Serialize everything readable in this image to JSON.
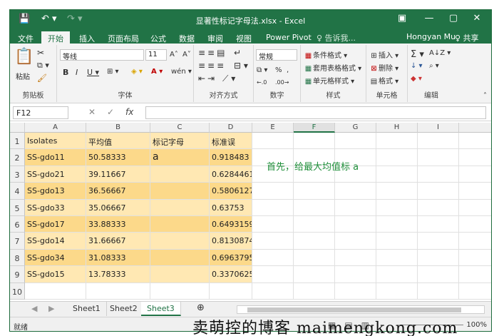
{
  "app": {
    "title": "显著性标记字母法.xlsx - Excel",
    "qa_save": "💾",
    "qa_undo": "↶ ▾",
    "qa_redo": "↷ ▾",
    "win_ribbon_opt": "▣",
    "win_min": "—",
    "win_max": "▢",
    "win_close": "✕"
  },
  "tabs": [
    "文件",
    "开始",
    "插入",
    "页面布局",
    "公式",
    "数据",
    "审阅",
    "视图",
    "Power Pivot"
  ],
  "tell_me": "♀ 告诉我...",
  "user": "Hongyan Mu",
  "share": "♀ 共享",
  "ribbon": {
    "clipboard": {
      "label": "剪贴板",
      "paste": "粘贴"
    },
    "font": {
      "label": "字体",
      "name": "等线",
      "size": "11",
      "grow": "A˄",
      "shrink": "A˅",
      "bold": "B",
      "italic": "I",
      "underline": "U ▾",
      "border": "⊞ ▾",
      "fill": "◈ ▾",
      "color": "A ▾",
      "wen": "wén ▾"
    },
    "align": {
      "label": "对齐方式"
    },
    "number": {
      "label": "数字",
      "format": "常规",
      "currency": "⧉ ▾",
      "percent": "%",
      "comma": ",",
      "inc": "←.0",
      "dec": ".00→"
    },
    "styles": {
      "label": "样式",
      "cond": "条件格式 ▾",
      "table": "套用表格格式 ▾",
      "cell": "单元格样式 ▾"
    },
    "cells": {
      "label": "单元格",
      "insert": "插入 ▾",
      "delete": "删除 ▾",
      "format": "格式 ▾"
    },
    "editing": {
      "label": "编辑",
      "sum": "Σ ▾",
      "sort": "A↓Z ▾",
      "fill": "↓ ▾",
      "find": "⌕ ▾",
      "clear": "◆ ▾"
    }
  },
  "formula_bar": {
    "name": "F12",
    "cancel": "✕",
    "enter": "✓",
    "fx": "fx",
    "value": ""
  },
  "columns": [
    "A",
    "B",
    "C",
    "D",
    "E",
    "F",
    "G",
    "H",
    "I"
  ],
  "rows": [
    "1",
    "2",
    "3",
    "4",
    "5",
    "6",
    "7",
    "8",
    "9",
    "10"
  ],
  "header_row": [
    "Isolates",
    "平均值",
    "标记字母",
    "标准误"
  ],
  "data_rows": [
    [
      "SS-gdo11",
      "50.58333",
      "a",
      "0.918483"
    ],
    [
      "SS-gdo21",
      "39.11667",
      "",
      "0.6284461"
    ],
    [
      "SS-gdo13",
      "36.56667",
      "",
      "0.5806127"
    ],
    [
      "SS-gdo33",
      "35.06667",
      "",
      "0.63753"
    ],
    [
      "SS-gdo17",
      "33.88333",
      "",
      "0.6493159"
    ],
    [
      "SS-gdo14",
      "31.66667",
      "",
      "0.8130874"
    ],
    [
      "SS-gdo34",
      "31.08333",
      "",
      "0.6963795"
    ],
    [
      "SS-gdo15",
      "13.78333",
      "",
      "0.3370625"
    ]
  ],
  "note": "首先，给最大均值标 a",
  "sheets": [
    "Sheet1",
    "Sheet2",
    "Sheet3"
  ],
  "active_sheet": "Sheet3",
  "add_sheet": "⊕",
  "status": {
    "ready": "就绪",
    "zoom": "100%"
  },
  "watermark": "卖萌控的博客 maimengkong.com",
  "colors": {
    "accent": "#217346",
    "highlight": "#ffe8b3",
    "highlight_alt": "#fcd98a",
    "note": "#1f8f3a"
  }
}
